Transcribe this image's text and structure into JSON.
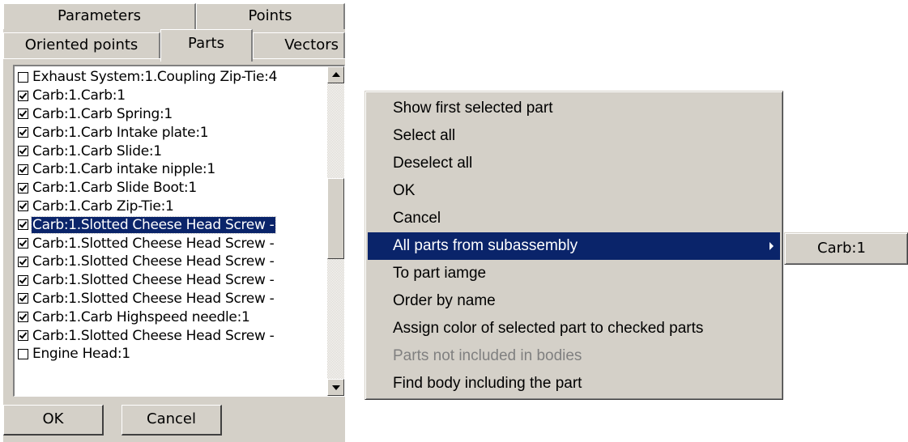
{
  "tabs": {
    "row1": [
      "Parameters",
      "Points"
    ],
    "row2": [
      "Oriented points",
      "Parts",
      "Vectors"
    ],
    "active": "Parts"
  },
  "parts_list": [
    {
      "label": "Exhaust System:1.Coupling Zip-Tie:4",
      "checked": false,
      "selected": false
    },
    {
      "label": "Carb:1.Carb:1",
      "checked": true,
      "selected": false
    },
    {
      "label": "Carb:1.Carb Spring:1",
      "checked": true,
      "selected": false
    },
    {
      "label": "Carb:1.Carb Intake plate:1",
      "checked": true,
      "selected": false
    },
    {
      "label": "Carb:1.Carb Slide:1",
      "checked": true,
      "selected": false
    },
    {
      "label": "Carb:1.Carb intake nipple:1",
      "checked": true,
      "selected": false
    },
    {
      "label": "Carb:1.Carb Slide Boot:1",
      "checked": true,
      "selected": false
    },
    {
      "label": "Carb:1.Carb Zip-Tie:1",
      "checked": true,
      "selected": false
    },
    {
      "label": "Carb:1.Slotted Cheese Head Screw -",
      "checked": true,
      "selected": true
    },
    {
      "label": "Carb:1.Slotted Cheese Head Screw -",
      "checked": true,
      "selected": false
    },
    {
      "label": "Carb:1.Slotted Cheese Head Screw -",
      "checked": true,
      "selected": false
    },
    {
      "label": "Carb:1.Slotted Cheese Head Screw -",
      "checked": true,
      "selected": false
    },
    {
      "label": "Carb:1.Slotted Cheese Head Screw -",
      "checked": true,
      "selected": false
    },
    {
      "label": "Carb:1.Carb Highspeed needle:1",
      "checked": true,
      "selected": false
    },
    {
      "label": "Carb:1.Slotted Cheese Head Screw -",
      "checked": true,
      "selected": false
    },
    {
      "label": "Engine Head:1",
      "checked": false,
      "selected": false
    }
  ],
  "buttons": {
    "ok": "OK",
    "cancel": "Cancel"
  },
  "context_menu": [
    {
      "label": "Show first selected part",
      "state": "normal"
    },
    {
      "label": "Select all",
      "state": "normal"
    },
    {
      "label": "Deselect all",
      "state": "normal"
    },
    {
      "label": "OK",
      "state": "normal"
    },
    {
      "label": "Cancel",
      "state": "normal"
    },
    {
      "label": "All parts from subassembly",
      "state": "active",
      "submenu": true
    },
    {
      "label": "To part iamge",
      "state": "normal"
    },
    {
      "label": "Order by name",
      "state": "normal"
    },
    {
      "label": "Assign color of selected part to checked parts",
      "state": "normal"
    },
    {
      "label": "Parts not included in bodies",
      "state": "disabled"
    },
    {
      "label": "Find body including the part",
      "state": "normal"
    }
  ],
  "submenu": {
    "items": [
      "Carb:1"
    ]
  },
  "colors": {
    "face": "#d4d0c8",
    "highlight": "#0a246a",
    "disabled_text": "#808080"
  }
}
